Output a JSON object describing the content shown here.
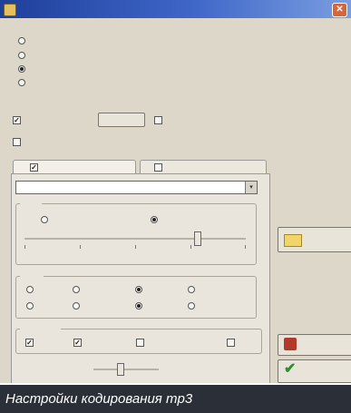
{
  "window": {
    "title": "",
    "close_glyph": "✕",
    "title_icon": "app-icon",
    "close_icon": "close-icon"
  },
  "source": {
    "heading": "",
    "options": [
      {
        "label": "",
        "selected": false
      },
      {
        "label": "",
        "selected": false
      },
      {
        "label": "",
        "selected": true
      },
      {
        "label": "",
        "selected": false
      }
    ]
  },
  "id3": {
    "checkbox_label": "",
    "checked": true,
    "edit_button_label": "",
    "second_checkbox_label": "",
    "second_checked": false,
    "third_checkbox_label": "",
    "third_checked": false
  },
  "tabs": [
    {
      "label": "",
      "active": true,
      "checked": true
    },
    {
      "label": "",
      "active": false,
      "checked": false
    }
  ],
  "encoder": {
    "selected_value": "",
    "dropdown_glyph": "▾",
    "bitrate_group_label": "",
    "bitrate_options": [
      {
        "label": "",
        "selected": false
      },
      {
        "label": "",
        "selected": true
      }
    ],
    "quality_slider_level": 0.78,
    "slider_left_label": "",
    "slider_right_label": "",
    "quality_group_label": "",
    "quality_options": [
      {
        "label": "",
        "selected": false
      },
      {
        "label": "",
        "selected": false
      },
      {
        "label": "",
        "selected": true
      },
      {
        "label": "",
        "selected": false
      },
      {
        "label": "",
        "selected": false
      },
      {
        "label": "",
        "selected": false
      },
      {
        "label": "",
        "selected": true
      },
      {
        "label": "",
        "selected": false
      }
    ],
    "flags_group_label": "",
    "flags": [
      {
        "label": "",
        "checked": true
      },
      {
        "label": "",
        "checked": true
      },
      {
        "label": "",
        "checked": false
      },
      {
        "label": "",
        "checked": false
      }
    ],
    "priority_label": "",
    "priority_value_label": "",
    "priority_level": 0.4
  },
  "side": {
    "copy_label": "",
    "browse_button_label": "",
    "cancel_button_label": "",
    "ok_button_label": "",
    "folder_icon": "folder-icon",
    "cancel_icon": "cancel-icon",
    "ok_icon": "checkmark-icon"
  },
  "caption": "Настройки кодирования mp3",
  "colors": {
    "dialog_bg": "#ddd7c9",
    "titlebar": "#3f67c8",
    "caption_bg": "#2b2f38",
    "ok_check": "#2f8f2f",
    "cancel_icon": "#b23a2a"
  }
}
